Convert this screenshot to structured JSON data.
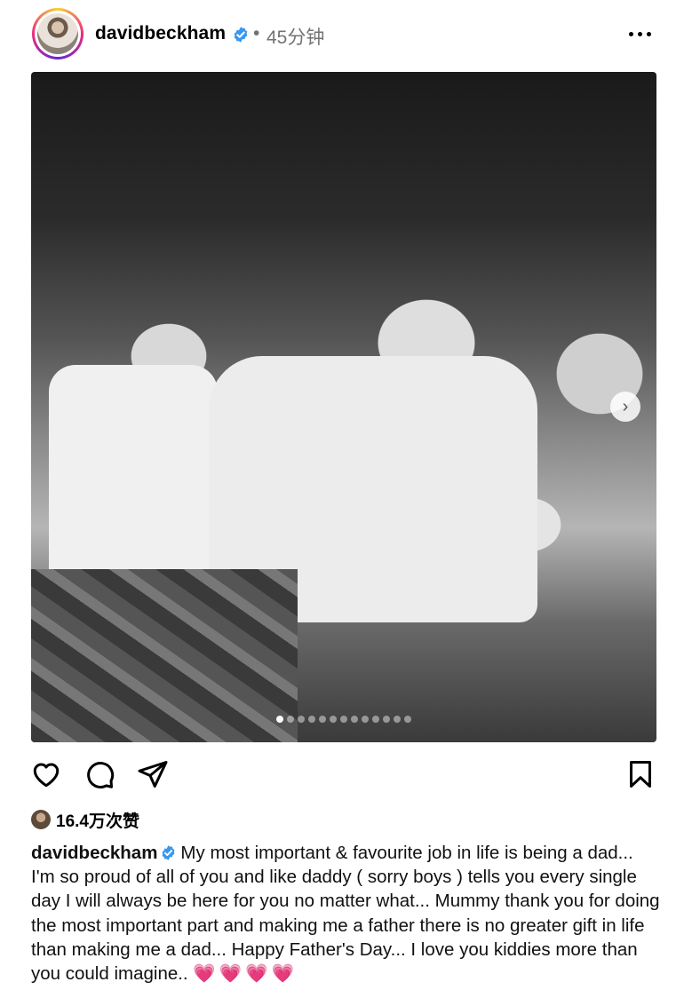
{
  "post": {
    "username": "davidbeckham",
    "separator": "•",
    "time_ago": "45分钟",
    "likes_count": "16.4万次赞",
    "caption_user": "davidbeckham",
    "caption_text": "My most important & favourite job in life is being a dad... I'm so proud of all of you and like daddy ( sorry boys ) tells you every single day I will always be here for you no matter what... Mummy thank you for doing the most important part and making me a father there is no greater gift in life than making me a dad... Happy Father's Day... I love you kiddies more than you could imagine.. ",
    "caption_emoji": "💗💗💗💗"
  },
  "carousel": {
    "total_slides": 13,
    "active_slide": 1
  },
  "icons": {
    "verified": "verified-badge-icon",
    "more": "more-horizontal-icon",
    "like": "heart-outline-icon",
    "comment": "comment-bubble-icon",
    "share": "paper-plane-icon",
    "save": "bookmark-icon",
    "next": "chevron-right-icon"
  },
  "colors": {
    "verified_blue": "#3897f0",
    "secondary_text": "#737373",
    "heart_pink": "#e33d9e"
  }
}
